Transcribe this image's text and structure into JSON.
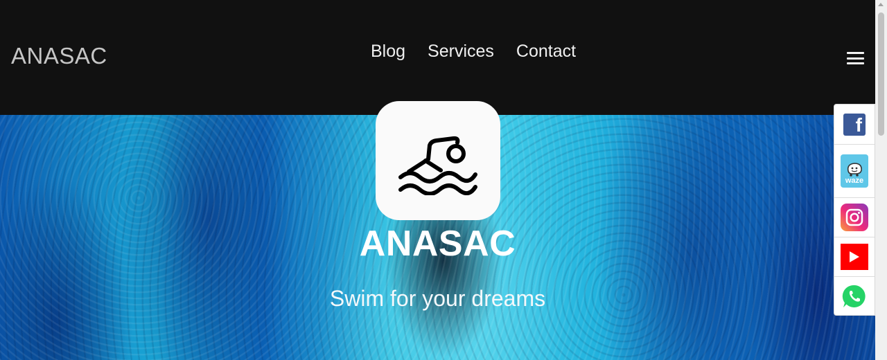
{
  "header": {
    "brand": "ANASAC",
    "nav": [
      "Blog",
      "Services",
      "Contact"
    ],
    "menu_icon": "hamburger-menu-icon"
  },
  "hero": {
    "logo_icon": "swimmer-icon",
    "title": "ANASAC",
    "tagline": "Swim for your dreams"
  },
  "social": [
    {
      "name": "facebook-icon",
      "text": "f",
      "color": "#3b5998"
    },
    {
      "name": "waze-icon",
      "text": "waze",
      "color": "#33ccff"
    },
    {
      "name": "instagram-icon",
      "color": "#e1306c"
    },
    {
      "name": "youtube-icon",
      "color": "#ff0000"
    },
    {
      "name": "whatsapp-icon",
      "color": "#25d366"
    }
  ]
}
